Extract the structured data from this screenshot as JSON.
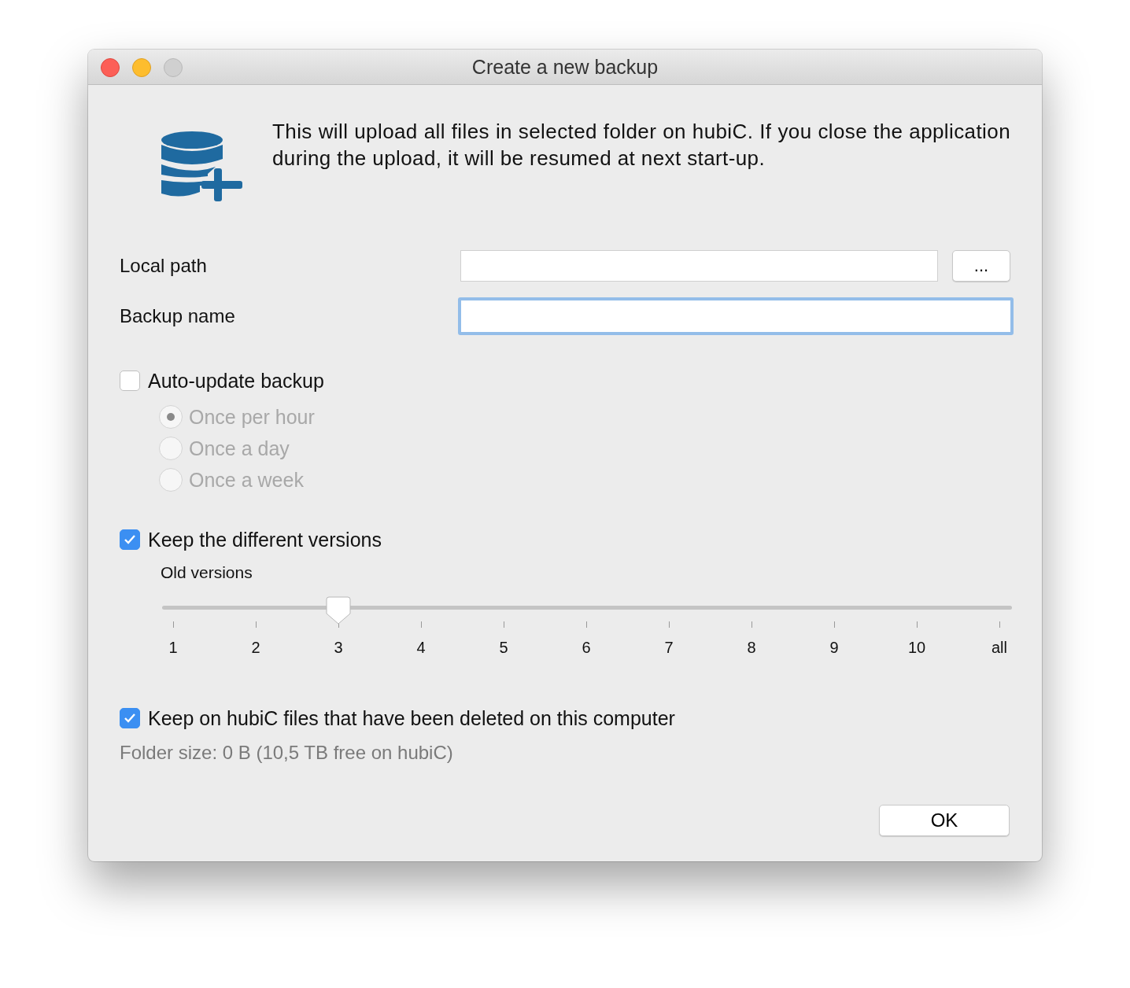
{
  "window": {
    "title": "Create a new backup"
  },
  "description": "This will upload all files in selected folder on hubiC. If you close the application during the upload, it will be resumed at next start-up.",
  "fields": [
    {
      "label": "Local path",
      "focused": false,
      "browse_button": "..."
    },
    {
      "label": "Backup name",
      "focused": true
    }
  ],
  "auto_update": {
    "label": "Auto-update backup",
    "checked": false,
    "options": [
      {
        "label": "Once per hour",
        "selected": true
      },
      {
        "label": "Once a day",
        "selected": false
      },
      {
        "label": "Once a week",
        "selected": false
      }
    ]
  },
  "keep_versions": {
    "label": "Keep the different versions",
    "checked": true,
    "slider_label": "Old versions",
    "level": 0.2,
    "ticks": [
      "1",
      "2",
      "3",
      "4",
      "5",
      "6",
      "7",
      "8",
      "9",
      "10",
      "all"
    ]
  },
  "keep_deleted": {
    "label": "Keep on hubiC files that have been deleted on this computer",
    "checked": true
  },
  "folder_size": "Folder size: 0 B (10,5 TB free on hubiC)",
  "ok_button": "OK"
}
